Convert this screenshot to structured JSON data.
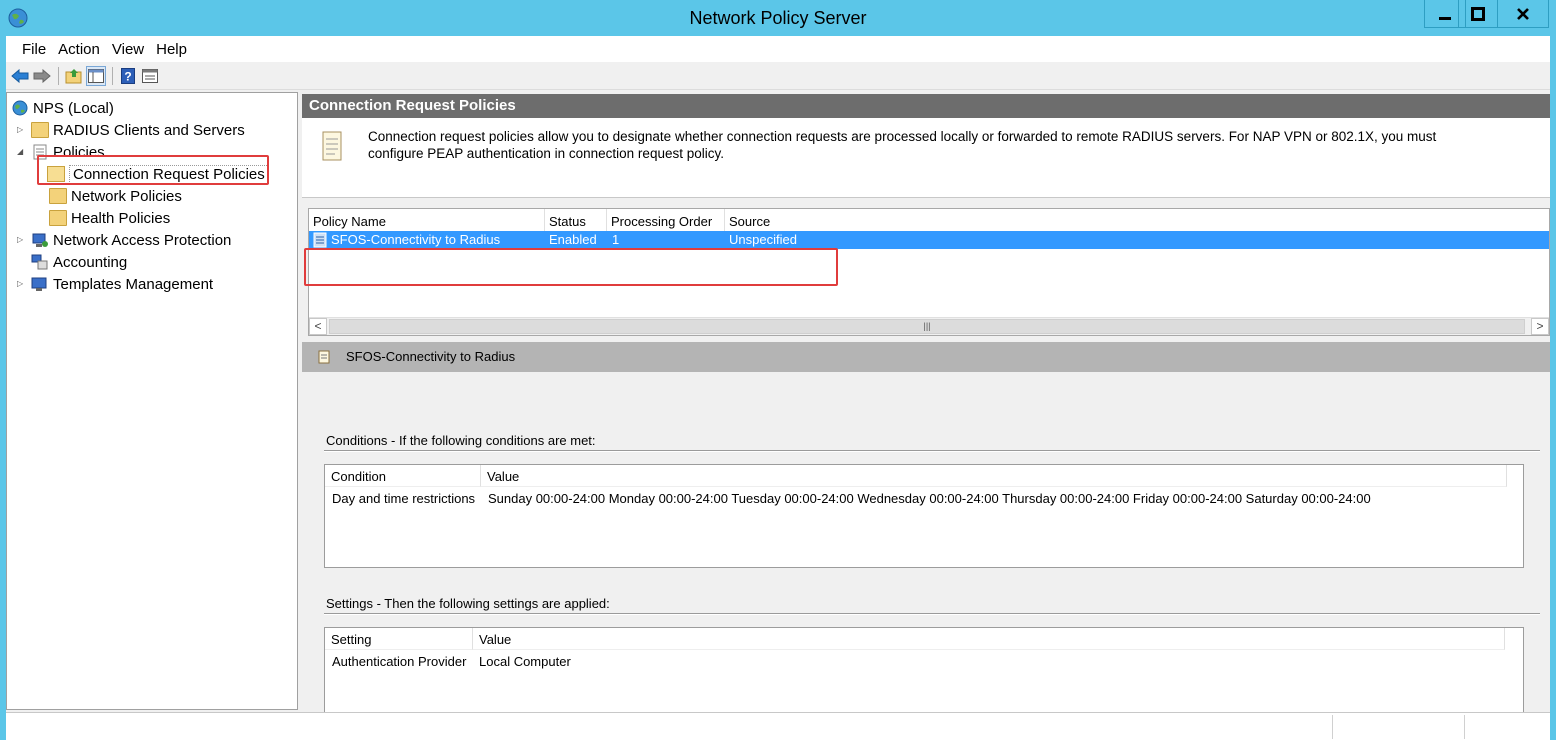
{
  "window": {
    "title": "Network Policy Server"
  },
  "menu": [
    "File",
    "Action",
    "View",
    "Help"
  ],
  "toolbar": [
    "back-icon",
    "forward-icon",
    "up-folder-icon",
    "show-hide-tree-icon",
    "help-icon",
    "properties-icon"
  ],
  "tree": {
    "root": "NPS (Local)",
    "radius_clients": "RADIUS Clients and Servers",
    "policies": "Policies",
    "connection_request_policies": "Connection Request Policies",
    "network_policies": "Network Policies",
    "health_policies": "Health Policies",
    "nap": "Network Access Protection",
    "accounting": "Accounting",
    "templates": "Templates Management"
  },
  "main": {
    "header": "Connection Request Policies",
    "description_line1": "Connection request policies allow you to designate whether connection requests are processed locally or forwarded to remote RADIUS servers. For NAP VPN or 802.1X, you must",
    "description_line2": "configure PEAP authentication in connection request policy.",
    "columns": [
      "Policy Name",
      "Status",
      "Processing Order",
      "Source"
    ],
    "rows": [
      {
        "name": "SFOS-Connectivity to Radius",
        "status": "Enabled",
        "order": "1",
        "source": "Unspecified"
      }
    ]
  },
  "detail": {
    "title": "SFOS-Connectivity to Radius",
    "conditions_title": "Conditions - If the following conditions are met:",
    "conditions_columns": [
      "Condition",
      "Value"
    ],
    "conditions_rows": [
      {
        "condition": "Day and time restrictions",
        "value": "Sunday 00:00-24:00 Monday 00:00-24:00 Tuesday 00:00-24:00 Wednesday 00:00-24:00 Thursday 00:00-24:00 Friday 00:00-24:00 Saturday 00:00-24:00"
      }
    ],
    "settings_title": "Settings - Then the following settings are applied:",
    "settings_columns": [
      "Setting",
      "Value"
    ],
    "settings_rows": [
      {
        "setting": "Authentication Provider",
        "value": "Local Computer"
      }
    ]
  },
  "colors": {
    "titlebar": "#5bc6e8",
    "selection": "#3399ff",
    "highlight_box": "#e03c3c",
    "panel_header": "#6d6d6d"
  }
}
